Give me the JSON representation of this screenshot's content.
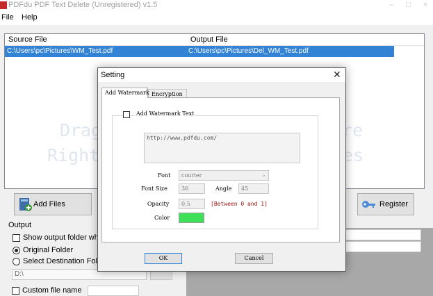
{
  "app": {
    "title": "PDFdu PDF Text Delete (Unregistered) v1.5",
    "window_controls": "–□×"
  },
  "menu": {
    "file": "File",
    "help": "Help"
  },
  "file_list": {
    "columns": [
      "Source File",
      "Output File"
    ],
    "rows": [
      {
        "source": "C:\\Users\\pc\\Pictures\\WM_Test.pdf",
        "output": "C:\\Users\\pc\\Pictures\\Del_WM_Test.pdf"
      }
    ],
    "hint_line1_left": "Drag",
    "hint_line1_right": "here",
    "hint_line2_left": "Right",
    "hint_line2_right": "les"
  },
  "buttons": {
    "add_files": "Add Files",
    "register": "Register"
  },
  "output": {
    "label": "Output",
    "show_folder_label": "Show output folder when d",
    "original_folder_label": "Original Folder",
    "select_folder_label": "Select Destination Folder",
    "path_value": "D:\\",
    "custom_name_label": "Custom file name"
  },
  "dialog": {
    "title": "Setting",
    "close_glyph": "✕",
    "tabs": [
      "Add Watermark",
      "Encryption"
    ],
    "add_watermark_text_label": "Add Watermark Text",
    "watermark_text": "http://www.pdfdu.com/",
    "font_label": "Font",
    "font_value": "courier",
    "font_size_label": "Font Size",
    "font_size_value": "36",
    "angle_label": "Angle",
    "angle_value": "45",
    "opacity_label": "Opacity",
    "opacity_value": "0.5",
    "opacity_hint": "[Between 0 and 1]",
    "color_label": "Color",
    "color_value": "#3ee05a",
    "ok_label": "OK",
    "cancel_label": "Cancel"
  },
  "colors": {
    "selection": "#3282d5",
    "hint_red": "#9e1010"
  },
  "icons": {
    "add_files": "add-files-icon",
    "register": "key-icon"
  }
}
